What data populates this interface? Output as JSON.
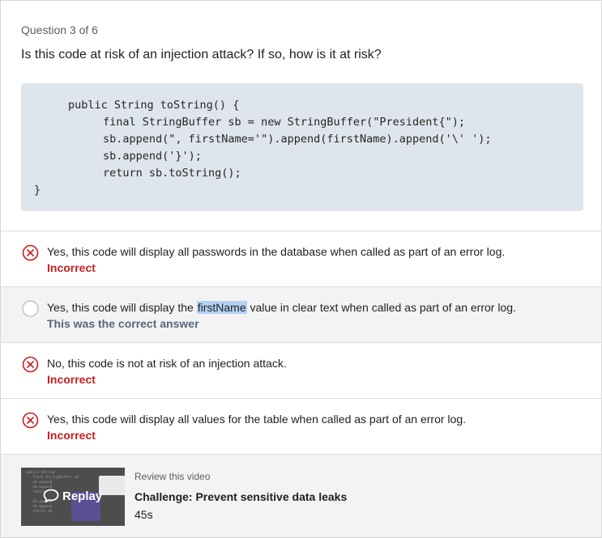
{
  "question": {
    "counter": "Question 3 of 6",
    "text": "Is this code at risk of an injection attack? If so, how is it at risk?"
  },
  "code_lines": [
    "public String toString() {",
    "final StringBuffer sb = new StringBuffer(\"President{\");",
    "sb.append(\", firstName='\").append(firstName).append('\\' ');",
    "sb.append('}');",
    "return sb.toString();",
    "}"
  ],
  "options": [
    {
      "text": "Yes, this code will display all passwords in the database when called as part of an error log.",
      "result": "Incorrect",
      "status": "incorrect",
      "icon": "x-circle-icon"
    },
    {
      "text_before": "Yes, this code will display the ",
      "text_highlight": "firstName",
      "text_after": " value in clear text when called as part of an error log.",
      "result": "This was the correct answer",
      "status": "correct",
      "icon": "empty-radio-icon"
    },
    {
      "text": "No, this code is not at risk of an injection attack.",
      "result": "Incorrect",
      "status": "incorrect",
      "icon": "x-circle-icon"
    },
    {
      "text": "Yes, this code will display all values for the table when called as part of an error log.",
      "result": "Incorrect",
      "status": "incorrect",
      "icon": "x-circle-icon"
    }
  ],
  "video": {
    "review_label": "Review this video",
    "title": "Challenge: Prevent sensitive data leaks",
    "duration": "45s",
    "replay_label": "Replay",
    "replay_icon": "speech-bubble-icon"
  },
  "colors": {
    "incorrect": "#c81d1d",
    "correct": "#56677a",
    "highlight": "#b5d2f5",
    "code_bg": "#dfe5ec"
  }
}
